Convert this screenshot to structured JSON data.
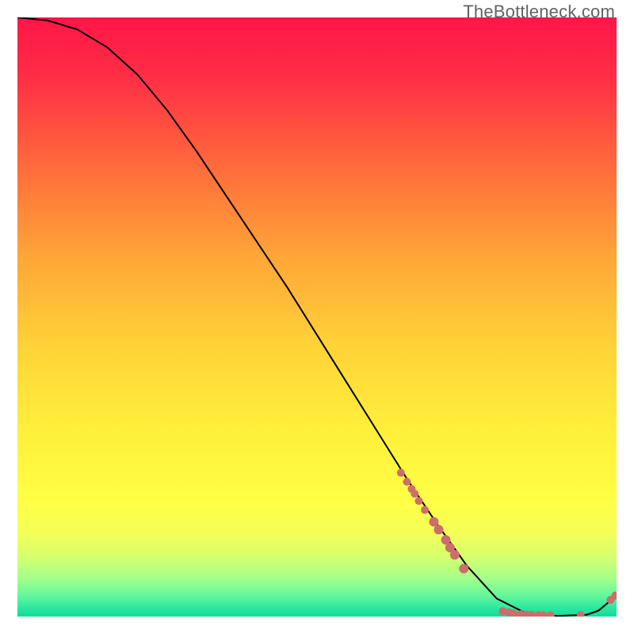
{
  "watermark": "TheBottleneck.com",
  "chart_data": {
    "type": "line",
    "title": "",
    "xlabel": "",
    "ylabel": "",
    "xlim": [
      0,
      100
    ],
    "ylim": [
      0,
      100
    ],
    "grid": false,
    "series": [
      {
        "name": "curve",
        "x": [
          0,
          5,
          10,
          15,
          20,
          25,
          30,
          35,
          40,
          45,
          50,
          55,
          60,
          65,
          70,
          75,
          80,
          85,
          90,
          95,
          97,
          100
        ],
        "values": [
          100,
          99.5,
          98.0,
          95.0,
          90.5,
          84.5,
          77.5,
          70.0,
          62.5,
          55.0,
          47.0,
          39.0,
          31.0,
          23.0,
          15.5,
          8.5,
          3.0,
          0.5,
          0.1,
          0.3,
          1.0,
          3.5
        ]
      }
    ],
    "markers": {
      "name": "highlighted-points",
      "color": "#cc6e6c",
      "points": [
        {
          "x": 64.0,
          "y": 24.0,
          "r": 5
        },
        {
          "x": 65.0,
          "y": 22.5,
          "r": 5
        },
        {
          "x": 65.8,
          "y": 21.3,
          "r": 5
        },
        {
          "x": 66.3,
          "y": 20.5,
          "r": 5
        },
        {
          "x": 67.0,
          "y": 19.3,
          "r": 5
        },
        {
          "x": 68.0,
          "y": 17.8,
          "r": 5
        },
        {
          "x": 69.5,
          "y": 15.8,
          "r": 6
        },
        {
          "x": 70.3,
          "y": 14.5,
          "r": 6
        },
        {
          "x": 71.5,
          "y": 12.8,
          "r": 6
        },
        {
          "x": 72.2,
          "y": 11.5,
          "r": 6
        },
        {
          "x": 73.0,
          "y": 10.3,
          "r": 6
        },
        {
          "x": 74.5,
          "y": 8.0,
          "r": 6
        },
        {
          "x": 81.0,
          "y": 0.9,
          "r": 5
        },
        {
          "x": 82.0,
          "y": 0.7,
          "r": 5
        },
        {
          "x": 82.8,
          "y": 0.55,
          "r": 5
        },
        {
          "x": 84.0,
          "y": 0.4,
          "r": 5
        },
        {
          "x": 85.0,
          "y": 0.35,
          "r": 5
        },
        {
          "x": 85.8,
          "y": 0.3,
          "r": 5
        },
        {
          "x": 87.0,
          "y": 0.25,
          "r": 5
        },
        {
          "x": 87.8,
          "y": 0.22,
          "r": 5
        },
        {
          "x": 89.0,
          "y": 0.2,
          "r": 5
        },
        {
          "x": 94.0,
          "y": 0.25,
          "r": 5
        },
        {
          "x": 99.0,
          "y": 2.8,
          "r": 5
        },
        {
          "x": 99.8,
          "y": 3.5,
          "r": 5
        }
      ]
    },
    "background_gradient": {
      "type": "vertical",
      "stops": [
        {
          "pos": 0.0,
          "color": "#ff1649"
        },
        {
          "pos": 0.1,
          "color": "#ff2e45"
        },
        {
          "pos": 0.25,
          "color": "#ff6b3b"
        },
        {
          "pos": 0.4,
          "color": "#ffa637"
        },
        {
          "pos": 0.55,
          "color": "#ffd338"
        },
        {
          "pos": 0.7,
          "color": "#fff13b"
        },
        {
          "pos": 0.81,
          "color": "#ffff45"
        },
        {
          "pos": 0.86,
          "color": "#f4ff57"
        },
        {
          "pos": 0.9,
          "color": "#d5ff6e"
        },
        {
          "pos": 0.935,
          "color": "#a6ff88"
        },
        {
          "pos": 0.965,
          "color": "#64f79d"
        },
        {
          "pos": 0.985,
          "color": "#2de8a0"
        },
        {
          "pos": 1.0,
          "color": "#13da9b"
        }
      ]
    }
  }
}
